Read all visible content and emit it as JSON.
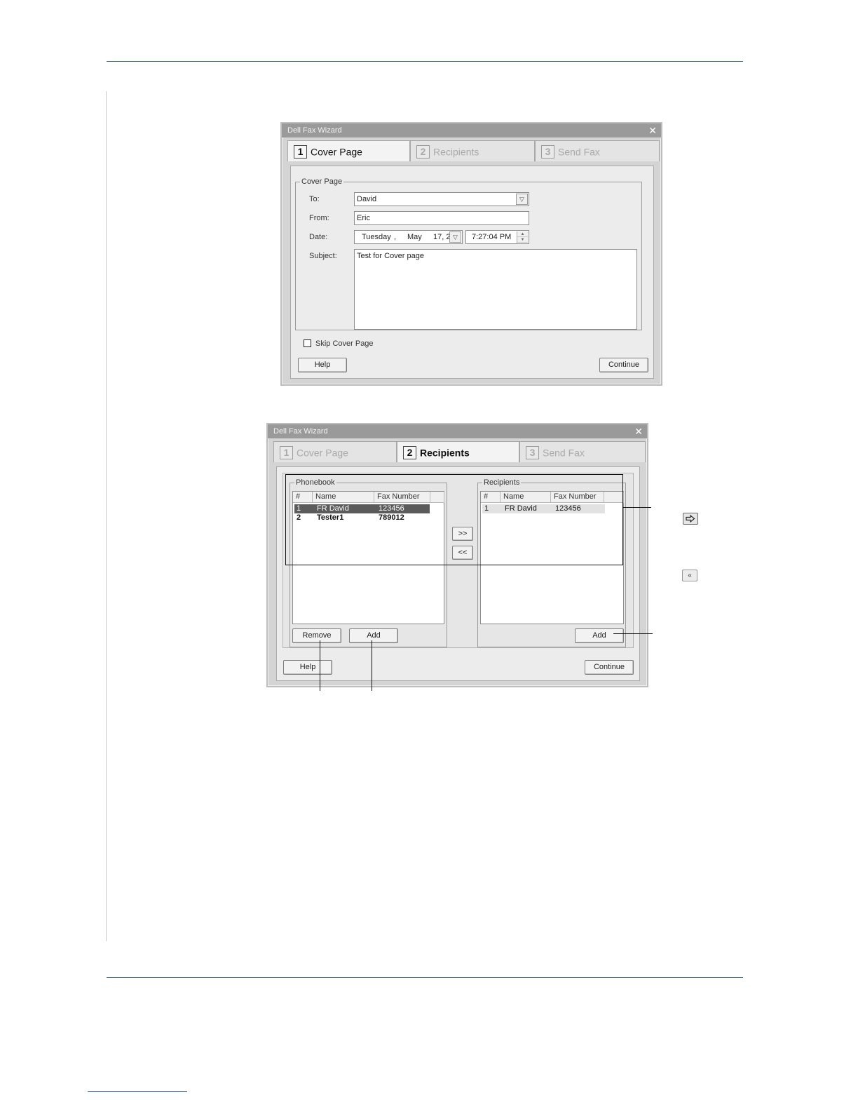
{
  "wizard1": {
    "title": "Dell Fax Wizard",
    "tabs": [
      {
        "num": "1",
        "label": "Cover Page"
      },
      {
        "num": "2",
        "label": "Recipients"
      },
      {
        "num": "3",
        "label": "Send Fax"
      }
    ],
    "group_label": "Cover Page",
    "to_label": "To:",
    "to_value": "David",
    "from_label": "From:",
    "from_value": "Eric",
    "date_label": "Date:",
    "date_day": "Tuesday",
    "date_sep": ",",
    "date_month": "May",
    "date_daynum": "17, 2",
    "time_value": "7:27:04 PM",
    "subject_label": "Subject:",
    "subject_value": "Test for Cover page",
    "skip_label": "Skip Cover Page",
    "help_label": "Help",
    "continue_label": "Continue"
  },
  "wizard2": {
    "title": "Dell Fax Wizard",
    "tabs": [
      {
        "num": "1",
        "label": "Cover Page"
      },
      {
        "num": "2",
        "label": "Recipients"
      },
      {
        "num": "3",
        "label": "Send Fax"
      }
    ],
    "phonebook_label": "Phonebook",
    "recipients_label": "Recipients",
    "columns": [
      "#",
      "Name",
      "Fax Number"
    ],
    "phonebook_rows": [
      {
        "num": "1",
        "name": "FR David",
        "fax": "123456"
      },
      {
        "num": "2",
        "name": "Tester1",
        "fax": "789012"
      }
    ],
    "recipient_rows": [
      {
        "num": "1",
        "name": "FR David",
        "fax": "123456"
      }
    ],
    "add_to_label": ">>",
    "remove_from_label": "<<",
    "remove_label": "Remove",
    "add_label": "Add",
    "recipients_add_label": "Add",
    "help_label": "Help",
    "continue_label": "Continue"
  },
  "side_icons": {
    "arrow_icon": "right-arrow-icon",
    "back_icon_label": "«"
  }
}
